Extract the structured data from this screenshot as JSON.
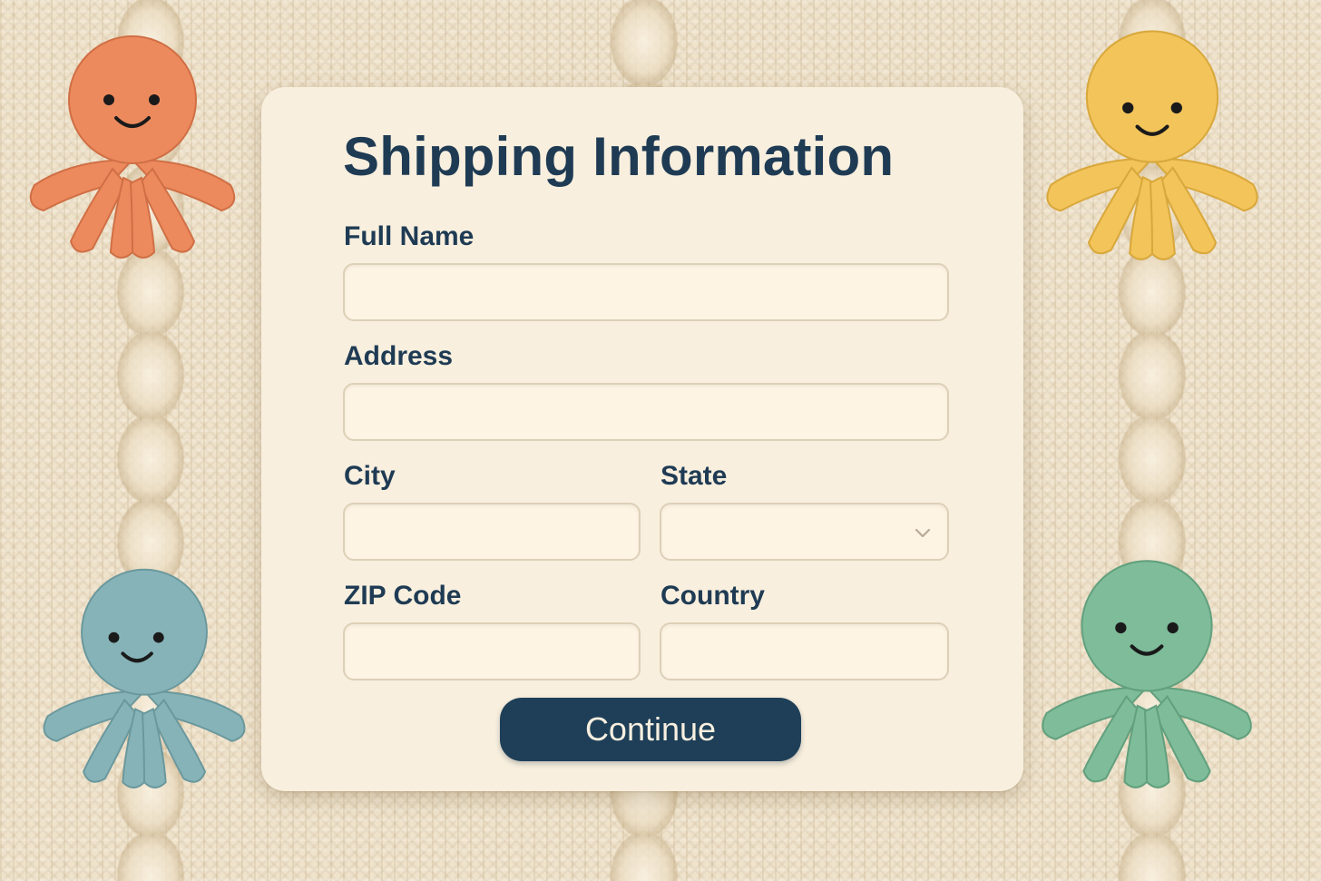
{
  "form": {
    "title": "Shipping Information",
    "full_name": {
      "label": "Full Name",
      "value": ""
    },
    "address": {
      "label": "Address",
      "value": ""
    },
    "city": {
      "label": "City",
      "value": ""
    },
    "state": {
      "label": "State",
      "value": ""
    },
    "zip": {
      "label": "ZIP Code",
      "value": ""
    },
    "country": {
      "label": "Country",
      "value": ""
    },
    "continue_label": "Continue"
  },
  "icons": {
    "state_dropdown": "chevron-down-icon"
  },
  "decorations": [
    {
      "name": "octopus-orange",
      "color": "#ec8a5e"
    },
    {
      "name": "octopus-yellow",
      "color": "#f2c45a"
    },
    {
      "name": "octopus-blue",
      "color": "#86b3b8"
    },
    {
      "name": "octopus-green",
      "color": "#7ebc9a"
    }
  ],
  "colors": {
    "background": "#efe3cc",
    "card": "#f8efde",
    "text": "#1f3b54",
    "button": "#1e3f57",
    "button_text": "#f7efe0",
    "field": "#fdf4e4",
    "field_border": "#ddd0b8"
  }
}
